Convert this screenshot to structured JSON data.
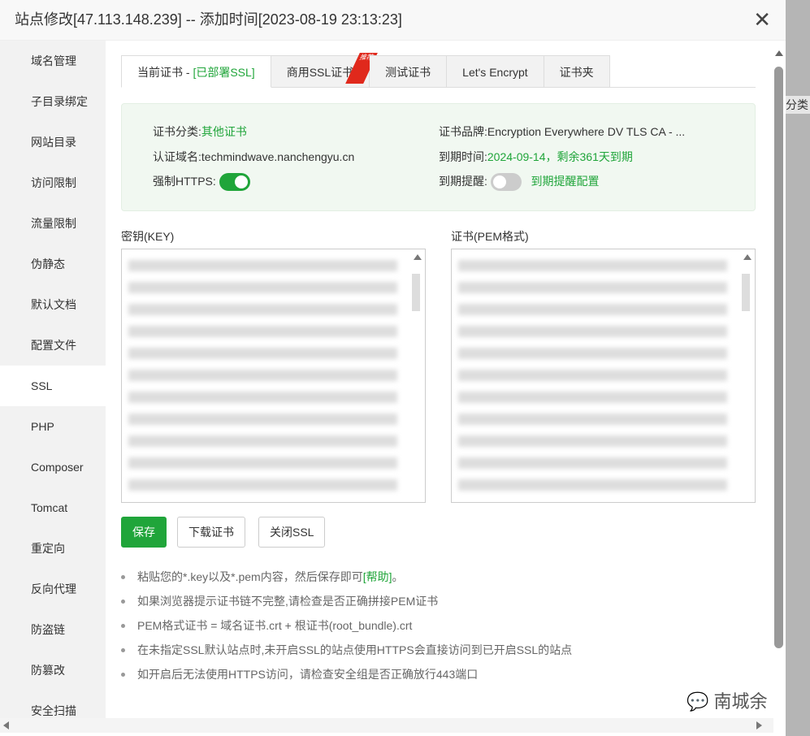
{
  "title": "站点修改[47.113.148.239] -- 添加时间[2023-08-19 23:13:23]",
  "background_fragment": "分类",
  "sidebar": {
    "items": [
      {
        "label": "域名管理"
      },
      {
        "label": "子目录绑定"
      },
      {
        "label": "网站目录"
      },
      {
        "label": "访问限制"
      },
      {
        "label": "流量限制"
      },
      {
        "label": "伪静态"
      },
      {
        "label": "默认文档"
      },
      {
        "label": "配置文件"
      },
      {
        "label": "SSL"
      },
      {
        "label": "PHP"
      },
      {
        "label": "Composer"
      },
      {
        "label": "Tomcat"
      },
      {
        "label": "重定向"
      },
      {
        "label": "反向代理"
      },
      {
        "label": "防盗链"
      },
      {
        "label": "防篡改"
      },
      {
        "label": "安全扫描"
      }
    ],
    "active": "SSL"
  },
  "tabs": [
    {
      "label": "当前证书 - ",
      "status": "[已部署SSL]"
    },
    {
      "label": "商用SSL证书",
      "badge": "推荐"
    },
    {
      "label": "测试证书"
    },
    {
      "label": "Let's Encrypt"
    },
    {
      "label": "证书夹"
    }
  ],
  "info": {
    "category_label": "证书分类:",
    "category": "其他证书",
    "brand_label": "证书品牌:",
    "brand": "Encryption Everywhere DV TLS CA - ...",
    "domain_label": "认证域名:",
    "domain": "techmindwave.nanchengyu.cn",
    "expire_label": "到期时间:",
    "expire": "2024-09-14，剩余361天到期",
    "https_label": "强制HTTPS:",
    "https_on": true,
    "remind_label": "到期提醒:",
    "remind_on": false,
    "remind_config": "到期提醒配置"
  },
  "key_label": "密钥(KEY)",
  "cert_label": "证书(PEM格式)",
  "buttons": {
    "save": "保存",
    "download": "下载证书",
    "close_ssl": "关闭SSL"
  },
  "notes": {
    "n1_pre": "粘贴您的*.key以及*.pem内容，然后保存即可",
    "n1_link": "[帮助]",
    "n1_post": "。",
    "n2": "如果浏览器提示证书链不完整,请检查是否正确拼接PEM证书",
    "n3": "PEM格式证书 = 域名证书.crt + 根证书(root_bundle).crt",
    "n4": "在未指定SSL默认站点时,未开启SSL的站点使用HTTPS会直接访问到已开启SSL的站点",
    "n5": "如开启后无法使用HTTPS访问，请检查安全组是否正确放行443端口"
  },
  "watermark": "南城余",
  "colors": {
    "accent": "#20a53a",
    "ribbon": "#e0291c"
  }
}
